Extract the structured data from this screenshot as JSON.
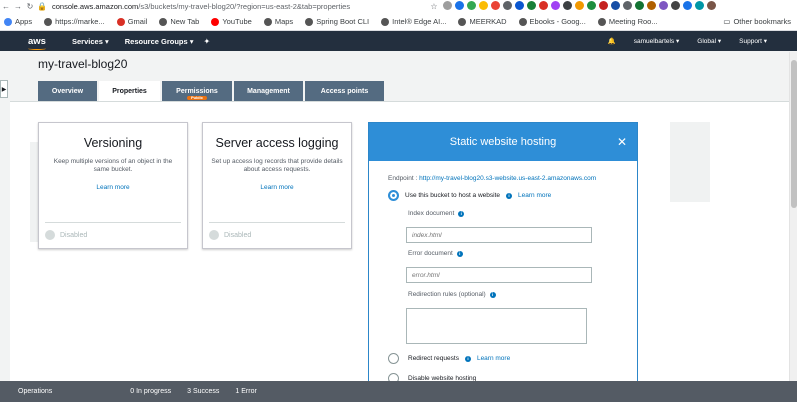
{
  "browser": {
    "url_host": "console.aws.amazon.com",
    "url_path": "/s3/buckets/my-travel-blog20/?region=us-east-2&tab=properties",
    "bookmarks": [
      {
        "label": "Apps",
        "color": "#4285f4"
      },
      {
        "label": "https://marke...",
        "color": "#555555"
      },
      {
        "label": "Gmail",
        "color": "#d93025"
      },
      {
        "label": "New Tab",
        "color": "#555555"
      },
      {
        "label": "YouTube",
        "color": "#ff0000"
      },
      {
        "label": "Maps",
        "color": "#555555"
      },
      {
        "label": "Spring Boot CLI",
        "color": "#555555"
      },
      {
        "label": "Intel® Edge AI...",
        "color": "#555555"
      },
      {
        "label": "MEERKAD",
        "color": "#555555"
      },
      {
        "label": "Ebooks - Goog...",
        "color": "#555555"
      },
      {
        "label": "Meeting Roo...",
        "color": "#555555"
      }
    ],
    "other_bookmarks": "Other bookmarks"
  },
  "aws_nav": {
    "logo": "aws",
    "services": "Services",
    "resource_groups": "Resource Groups",
    "user": "samuelbartels",
    "region": "Global",
    "support": "Support"
  },
  "bucket": {
    "name": "my-travel-blog20",
    "tabs": [
      {
        "label": "Overview",
        "active": false
      },
      {
        "label": "Properties",
        "active": true
      },
      {
        "label": "Permissions",
        "active": false,
        "badge": "Public"
      },
      {
        "label": "Management",
        "active": false
      },
      {
        "label": "Access points",
        "active": false
      }
    ]
  },
  "cards": {
    "versioning": {
      "title": "Versioning",
      "description": "Keep multiple versions of an object in the same bucket.",
      "learn_more": "Learn more",
      "state": "Disabled"
    },
    "logging": {
      "title": "Server access logging",
      "description": "Set up access log records that provide details about access requests.",
      "learn_more": "Learn more",
      "state": "Disabled"
    }
  },
  "static_hosting": {
    "title": "Static website hosting",
    "endpoint_label": "Endpoint :",
    "endpoint_url": "http://my-travel-blog20.s3-website.us-east-2.amazonaws.com",
    "use_bucket": "Use this bucket to host a website",
    "learn_more": "Learn more",
    "index_label": "Index document",
    "index_placeholder": "index.html",
    "error_label": "Error document",
    "error_placeholder": "error.html",
    "redirection_label": "Redirection rules (optional)",
    "redirect_requests": "Redirect requests",
    "redirect_learn_more": "Learn more",
    "disable": "Disable website hosting"
  },
  "operations": {
    "title": "Operations",
    "in_progress": "0 In progress",
    "success": "3 Success",
    "error": "1 Error"
  },
  "colors": {
    "aws_nav": "#232f3e",
    "accent": "#2e8ed7",
    "tab_bg": "#546b81",
    "ops_bar": "#545b64"
  }
}
